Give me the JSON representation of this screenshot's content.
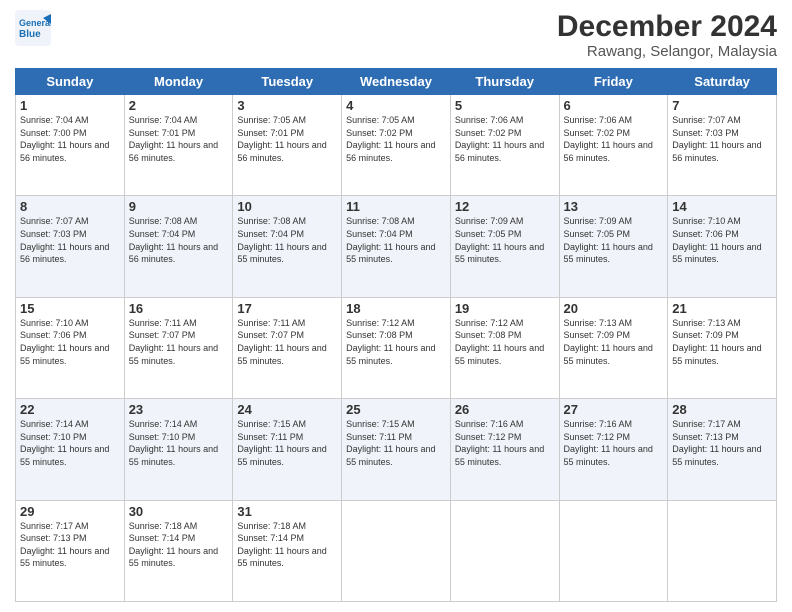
{
  "logo": {
    "line1": "General",
    "line2": "Blue"
  },
  "title": "December 2024",
  "subtitle": "Rawang, Selangor, Malaysia",
  "days_of_week": [
    "Sunday",
    "Monday",
    "Tuesday",
    "Wednesday",
    "Thursday",
    "Friday",
    "Saturday"
  ],
  "weeks": [
    [
      {
        "day": "1",
        "sunrise": "7:04 AM",
        "sunset": "7:00 PM",
        "daylight": "11 hours and 56 minutes."
      },
      {
        "day": "2",
        "sunrise": "7:04 AM",
        "sunset": "7:01 PM",
        "daylight": "11 hours and 56 minutes."
      },
      {
        "day": "3",
        "sunrise": "7:05 AM",
        "sunset": "7:01 PM",
        "daylight": "11 hours and 56 minutes."
      },
      {
        "day": "4",
        "sunrise": "7:05 AM",
        "sunset": "7:02 PM",
        "daylight": "11 hours and 56 minutes."
      },
      {
        "day": "5",
        "sunrise": "7:06 AM",
        "sunset": "7:02 PM",
        "daylight": "11 hours and 56 minutes."
      },
      {
        "day": "6",
        "sunrise": "7:06 AM",
        "sunset": "7:02 PM",
        "daylight": "11 hours and 56 minutes."
      },
      {
        "day": "7",
        "sunrise": "7:07 AM",
        "sunset": "7:03 PM",
        "daylight": "11 hours and 56 minutes."
      }
    ],
    [
      {
        "day": "8",
        "sunrise": "7:07 AM",
        "sunset": "7:03 PM",
        "daylight": "11 hours and 56 minutes."
      },
      {
        "day": "9",
        "sunrise": "7:08 AM",
        "sunset": "7:04 PM",
        "daylight": "11 hours and 56 minutes."
      },
      {
        "day": "10",
        "sunrise": "7:08 AM",
        "sunset": "7:04 PM",
        "daylight": "11 hours and 55 minutes."
      },
      {
        "day": "11",
        "sunrise": "7:08 AM",
        "sunset": "7:04 PM",
        "daylight": "11 hours and 55 minutes."
      },
      {
        "day": "12",
        "sunrise": "7:09 AM",
        "sunset": "7:05 PM",
        "daylight": "11 hours and 55 minutes."
      },
      {
        "day": "13",
        "sunrise": "7:09 AM",
        "sunset": "7:05 PM",
        "daylight": "11 hours and 55 minutes."
      },
      {
        "day": "14",
        "sunrise": "7:10 AM",
        "sunset": "7:06 PM",
        "daylight": "11 hours and 55 minutes."
      }
    ],
    [
      {
        "day": "15",
        "sunrise": "7:10 AM",
        "sunset": "7:06 PM",
        "daylight": "11 hours and 55 minutes."
      },
      {
        "day": "16",
        "sunrise": "7:11 AM",
        "sunset": "7:07 PM",
        "daylight": "11 hours and 55 minutes."
      },
      {
        "day": "17",
        "sunrise": "7:11 AM",
        "sunset": "7:07 PM",
        "daylight": "11 hours and 55 minutes."
      },
      {
        "day": "18",
        "sunrise": "7:12 AM",
        "sunset": "7:08 PM",
        "daylight": "11 hours and 55 minutes."
      },
      {
        "day": "19",
        "sunrise": "7:12 AM",
        "sunset": "7:08 PM",
        "daylight": "11 hours and 55 minutes."
      },
      {
        "day": "20",
        "sunrise": "7:13 AM",
        "sunset": "7:09 PM",
        "daylight": "11 hours and 55 minutes."
      },
      {
        "day": "21",
        "sunrise": "7:13 AM",
        "sunset": "7:09 PM",
        "daylight": "11 hours and 55 minutes."
      }
    ],
    [
      {
        "day": "22",
        "sunrise": "7:14 AM",
        "sunset": "7:10 PM",
        "daylight": "11 hours and 55 minutes."
      },
      {
        "day": "23",
        "sunrise": "7:14 AM",
        "sunset": "7:10 PM",
        "daylight": "11 hours and 55 minutes."
      },
      {
        "day": "24",
        "sunrise": "7:15 AM",
        "sunset": "7:11 PM",
        "daylight": "11 hours and 55 minutes."
      },
      {
        "day": "25",
        "sunrise": "7:15 AM",
        "sunset": "7:11 PM",
        "daylight": "11 hours and 55 minutes."
      },
      {
        "day": "26",
        "sunrise": "7:16 AM",
        "sunset": "7:12 PM",
        "daylight": "11 hours and 55 minutes."
      },
      {
        "day": "27",
        "sunrise": "7:16 AM",
        "sunset": "7:12 PM",
        "daylight": "11 hours and 55 minutes."
      },
      {
        "day": "28",
        "sunrise": "7:17 AM",
        "sunset": "7:13 PM",
        "daylight": "11 hours and 55 minutes."
      }
    ],
    [
      {
        "day": "29",
        "sunrise": "7:17 AM",
        "sunset": "7:13 PM",
        "daylight": "11 hours and 55 minutes."
      },
      {
        "day": "30",
        "sunrise": "7:18 AM",
        "sunset": "7:14 PM",
        "daylight": "11 hours and 55 minutes."
      },
      {
        "day": "31",
        "sunrise": "7:18 AM",
        "sunset": "7:14 PM",
        "daylight": "11 hours and 55 minutes."
      },
      null,
      null,
      null,
      null
    ]
  ]
}
